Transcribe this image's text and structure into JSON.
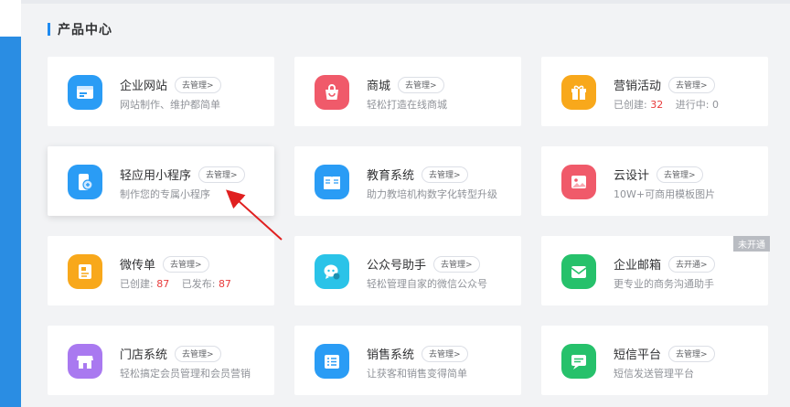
{
  "section": {
    "title": "产品中心"
  },
  "cards": [
    {
      "name": "企业网站",
      "badge": "去管理>",
      "desc": "网站制作、维护都简单",
      "icon": "browser-icon",
      "color": "#2a9cf5"
    },
    {
      "name": "商城",
      "badge": "去管理>",
      "desc": "轻松打造在线商城",
      "icon": "shopping-bag-icon",
      "color": "#f05a6a"
    },
    {
      "name": "营销活动",
      "badge": "去管理>",
      "desc_parts": {
        "created_label": "已创建:",
        "created_value": "32",
        "running_label": "进行中:",
        "running_value": "0"
      },
      "icon": "gift-icon",
      "color": "#f8a81b"
    },
    {
      "name": "轻应用小程序",
      "badge": "去管理>",
      "desc": "制作您的专属小程序",
      "icon": "mini-program-icon",
      "color": "#2a9cf5"
    },
    {
      "name": "教育系统",
      "badge": "去管理>",
      "desc": "助力教培机构数字化转型升级",
      "icon": "book-icon",
      "color": "#2a9cf5"
    },
    {
      "name": "云设计",
      "badge": "去管理>",
      "desc": "10W+可商用模板图片",
      "icon": "image-icon",
      "color": "#f05a6a"
    },
    {
      "name": "微传单",
      "badge": "去管理>",
      "desc_parts": {
        "created_label": "已创建:",
        "created_value": "87",
        "published_label": "已发布:",
        "published_value": "87"
      },
      "icon": "flyer-icon",
      "color": "#f8a81b"
    },
    {
      "name": "公众号助手",
      "badge": "去管理>",
      "desc": "轻松管理自家的微信公众号",
      "icon": "wechat-icon",
      "color": "#2ac3e8"
    },
    {
      "name": "企业邮箱",
      "badge": "去开通>",
      "desc": "更专业的商务沟通助手",
      "icon": "mail-icon",
      "color": "#26c16b"
    },
    {
      "name": "门店系统",
      "badge": "去管理>",
      "desc": "轻松搞定会员管理和会员营销",
      "icon": "store-icon",
      "color": "#a979f0"
    },
    {
      "name": "销售系统",
      "badge": "去管理>",
      "desc": "让获客和销售变得简单",
      "icon": "list-icon",
      "color": "#2a9cf5"
    },
    {
      "name": "短信平台",
      "badge": "去管理>",
      "desc": "短信发送管理平台",
      "icon": "message-icon",
      "color": "#26c16b"
    }
  ],
  "corner_tag": "未开通"
}
